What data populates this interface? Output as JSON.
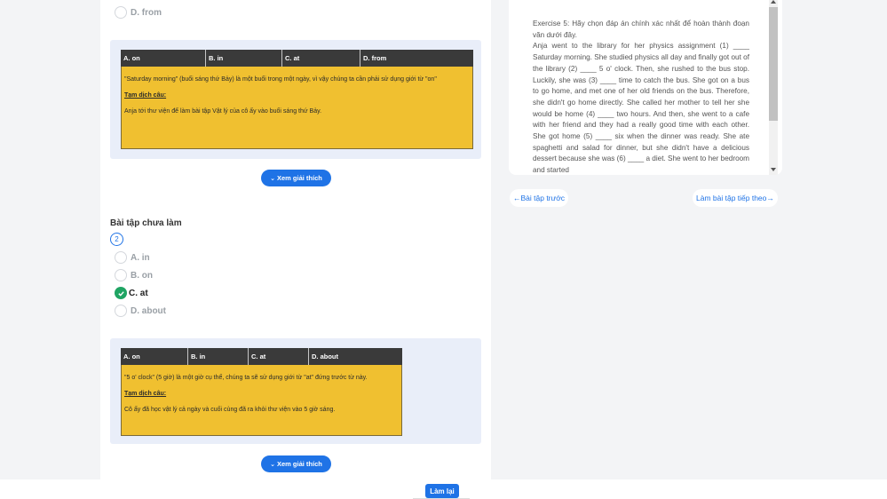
{
  "question1": {
    "option_d": "D. from",
    "answers": [
      "A. on",
      "B. in",
      "C. at",
      "D. from"
    ],
    "explanation": "\"Saturday morning\" (buổi sáng thứ Bảy) là một buổi trong một ngày, vì vậy chúng ta cần phải sử dụng giới từ \"on\"",
    "translation_label": "Tạm dịch câu:",
    "translation": "Anja tới thư viện để làm bài tập Vật lý của cô ấy vào buổi sáng thứ Bảy."
  },
  "explain_button_label": "Xem giải thích",
  "section_title": "Bài tập chưa làm",
  "question2": {
    "number": "2",
    "options": [
      "A. in",
      "B. on",
      "C. at",
      "D. about"
    ],
    "answers": [
      "A. on",
      "B. in",
      "C. at",
      "D. about"
    ],
    "explanation": "\"5 o' clock\" (5 giờ) là một giờ cụ thể, chúng ta sẽ sử dụng giới từ \"at\" đứng trước từ này.",
    "translation_label": "Tạm dịch câu:",
    "translation": "Cô ấy đã học vật lý cả ngày và cuối cùng đã ra khỏi thư viện vào 5 giờ sáng."
  },
  "passage": {
    "title": "Exercise 5: Hãy chọn đáp án chính xác nhất để hoàn thành đoạn văn dưới đây.",
    "body": "Anja went to the library for her physics assignment (1) ____ Saturday morning. She studied physics all day and finally got out of the library (2) ____ 5 o' clock. Then, she rushed to the bus stop. Luckily, she was (3) ____ time to catch the bus. She got on a bus to go home, and met one of her old friends on the bus. Therefore, she didn't go home directly. She called her mother to tell her she would be home (4) ____ two hours. And then, she went to a cafe with her friend and they had a really good time with each other. She got home (5) ____ six when the dinner was ready. She ate spaghetti and salad for dinner, but she didn't have a delicious dessert because she was (6) ____ a diet. She went to her bedroom and started"
  },
  "nav": {
    "prev": "←Bài tập trước",
    "next": "Làm bài tập tiếp theo→"
  },
  "redo_label": "Làm lại",
  "colors": {
    "accent": "#1f73e6",
    "correct": "#1fa463",
    "explanation_bg": "#f0c030",
    "header_bg": "#3a3a3a"
  }
}
